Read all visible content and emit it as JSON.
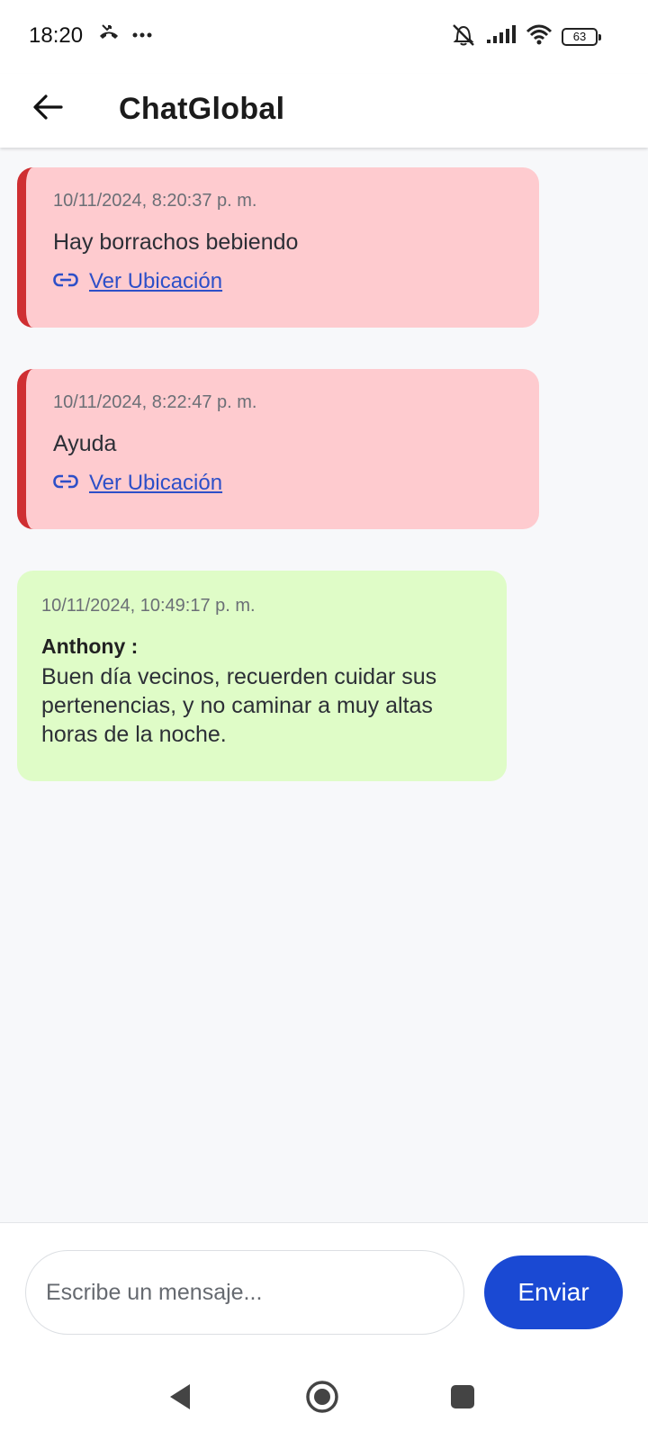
{
  "status_bar": {
    "time": "18:20",
    "battery_level": "63",
    "icons": [
      "missed-call-icon",
      "more-dots-icon",
      "vibrate-off-icon",
      "signal-icon",
      "wifi-icon",
      "battery-icon"
    ]
  },
  "app_bar": {
    "title": "ChatGlobal",
    "back_icon": "arrow-left-icon"
  },
  "messages": [
    {
      "type": "alert",
      "timestamp": "10/11/2024, 8:20:37 p. m.",
      "text": "Hay borrachos bebiendo",
      "link_label": "Ver Ubicación",
      "link_icon": "link-icon"
    },
    {
      "type": "alert",
      "timestamp": "10/11/2024, 8:22:47 p. m.",
      "text": "Ayuda",
      "link_label": "Ver Ubicación",
      "link_icon": "link-icon"
    },
    {
      "type": "normal",
      "timestamp": "10/11/2024, 10:49:17 p. m.",
      "sender": "Anthony :",
      "text": "Buen día vecinos, recuerden cuidar sus pertenencias, y no caminar a muy altas horas de la noche."
    }
  ],
  "composer": {
    "placeholder": "Escribe un mensaje...",
    "value": "",
    "send_label": "Enviar"
  },
  "nav_bar": {
    "icons": [
      "nav-back-icon",
      "nav-home-icon",
      "nav-recents-icon"
    ]
  },
  "colors": {
    "alert_bg": "#fecbcf",
    "alert_border": "#cf2f32",
    "normal_bg": "#dffcc7",
    "link": "#2d4fc8",
    "send_button": "#1a49d3"
  }
}
